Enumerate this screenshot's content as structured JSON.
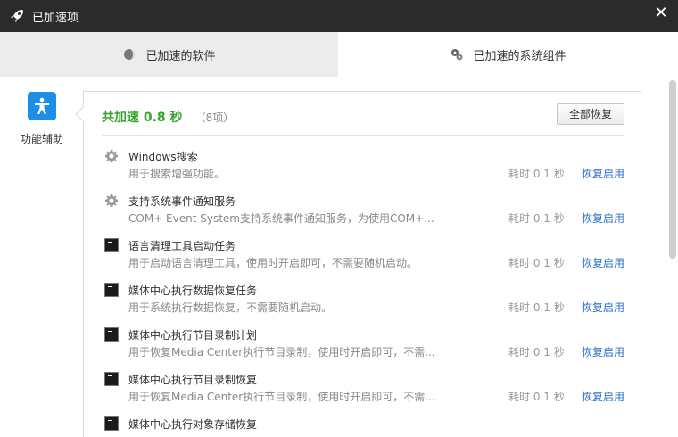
{
  "window": {
    "title": "已加速项",
    "close_glyph": "✕"
  },
  "tabs": [
    {
      "label": "已加速的软件",
      "icon": "software-icon",
      "active": true
    },
    {
      "label": "已加速的系统组件",
      "icon": "components-icon",
      "active": false
    }
  ],
  "sidebar": {
    "category": {
      "label": "功能辅助",
      "icon": "accessibility-icon",
      "color": "#1e8fe6"
    }
  },
  "summary": {
    "label": "共加速 0.8 秒",
    "count": "（8项）",
    "restore_all": "全部恢复",
    "accent": "#36a52e"
  },
  "items": [
    {
      "icon": "gear-icon",
      "name": "Windows搜索",
      "desc": "用于搜索增强功能。",
      "time": "耗时 0.1 秒",
      "action": "恢复启用"
    },
    {
      "icon": "gear-icon",
      "name": "支持系统事件通知服务",
      "desc": "COM+ Event System支持系统事件通知服务，为使用COM+...",
      "time": "耗时 0.1 秒",
      "action": "恢复启用"
    },
    {
      "icon": "cmd-icon",
      "name": "语言清理工具启动任务",
      "desc": "用于启动语言清理工具，使用时开启即可，不需要随机启动。",
      "time": "耗时 0.1 秒",
      "action": "恢复启用"
    },
    {
      "icon": "cmd-icon",
      "name": "媒体中心执行数据恢复任务",
      "desc": "用于系统执行数据恢复，不需要随机启动。",
      "time": "耗时 0.1 秒",
      "action": "恢复启用"
    },
    {
      "icon": "cmd-icon",
      "name": "媒体中心执行节目录制计划",
      "desc": "用于恢复Media Center执行节目录制，使用时开启即可，不需...",
      "time": "耗时 0.1 秒",
      "action": "恢复启用"
    },
    {
      "icon": "cmd-icon",
      "name": "媒体中心执行节目录制恢复",
      "desc": "用于恢复Media Center执行节目录制，使用时开启即可，不需...",
      "time": "耗时 0.1 秒",
      "action": "恢复启用"
    },
    {
      "icon": "cmd-icon",
      "name": "媒体中心执行对象存储恢复",
      "desc": "",
      "time": "",
      "action": ""
    }
  ],
  "colors": {
    "titlebar": "#2b2b2b",
    "link": "#2a6fc9"
  }
}
